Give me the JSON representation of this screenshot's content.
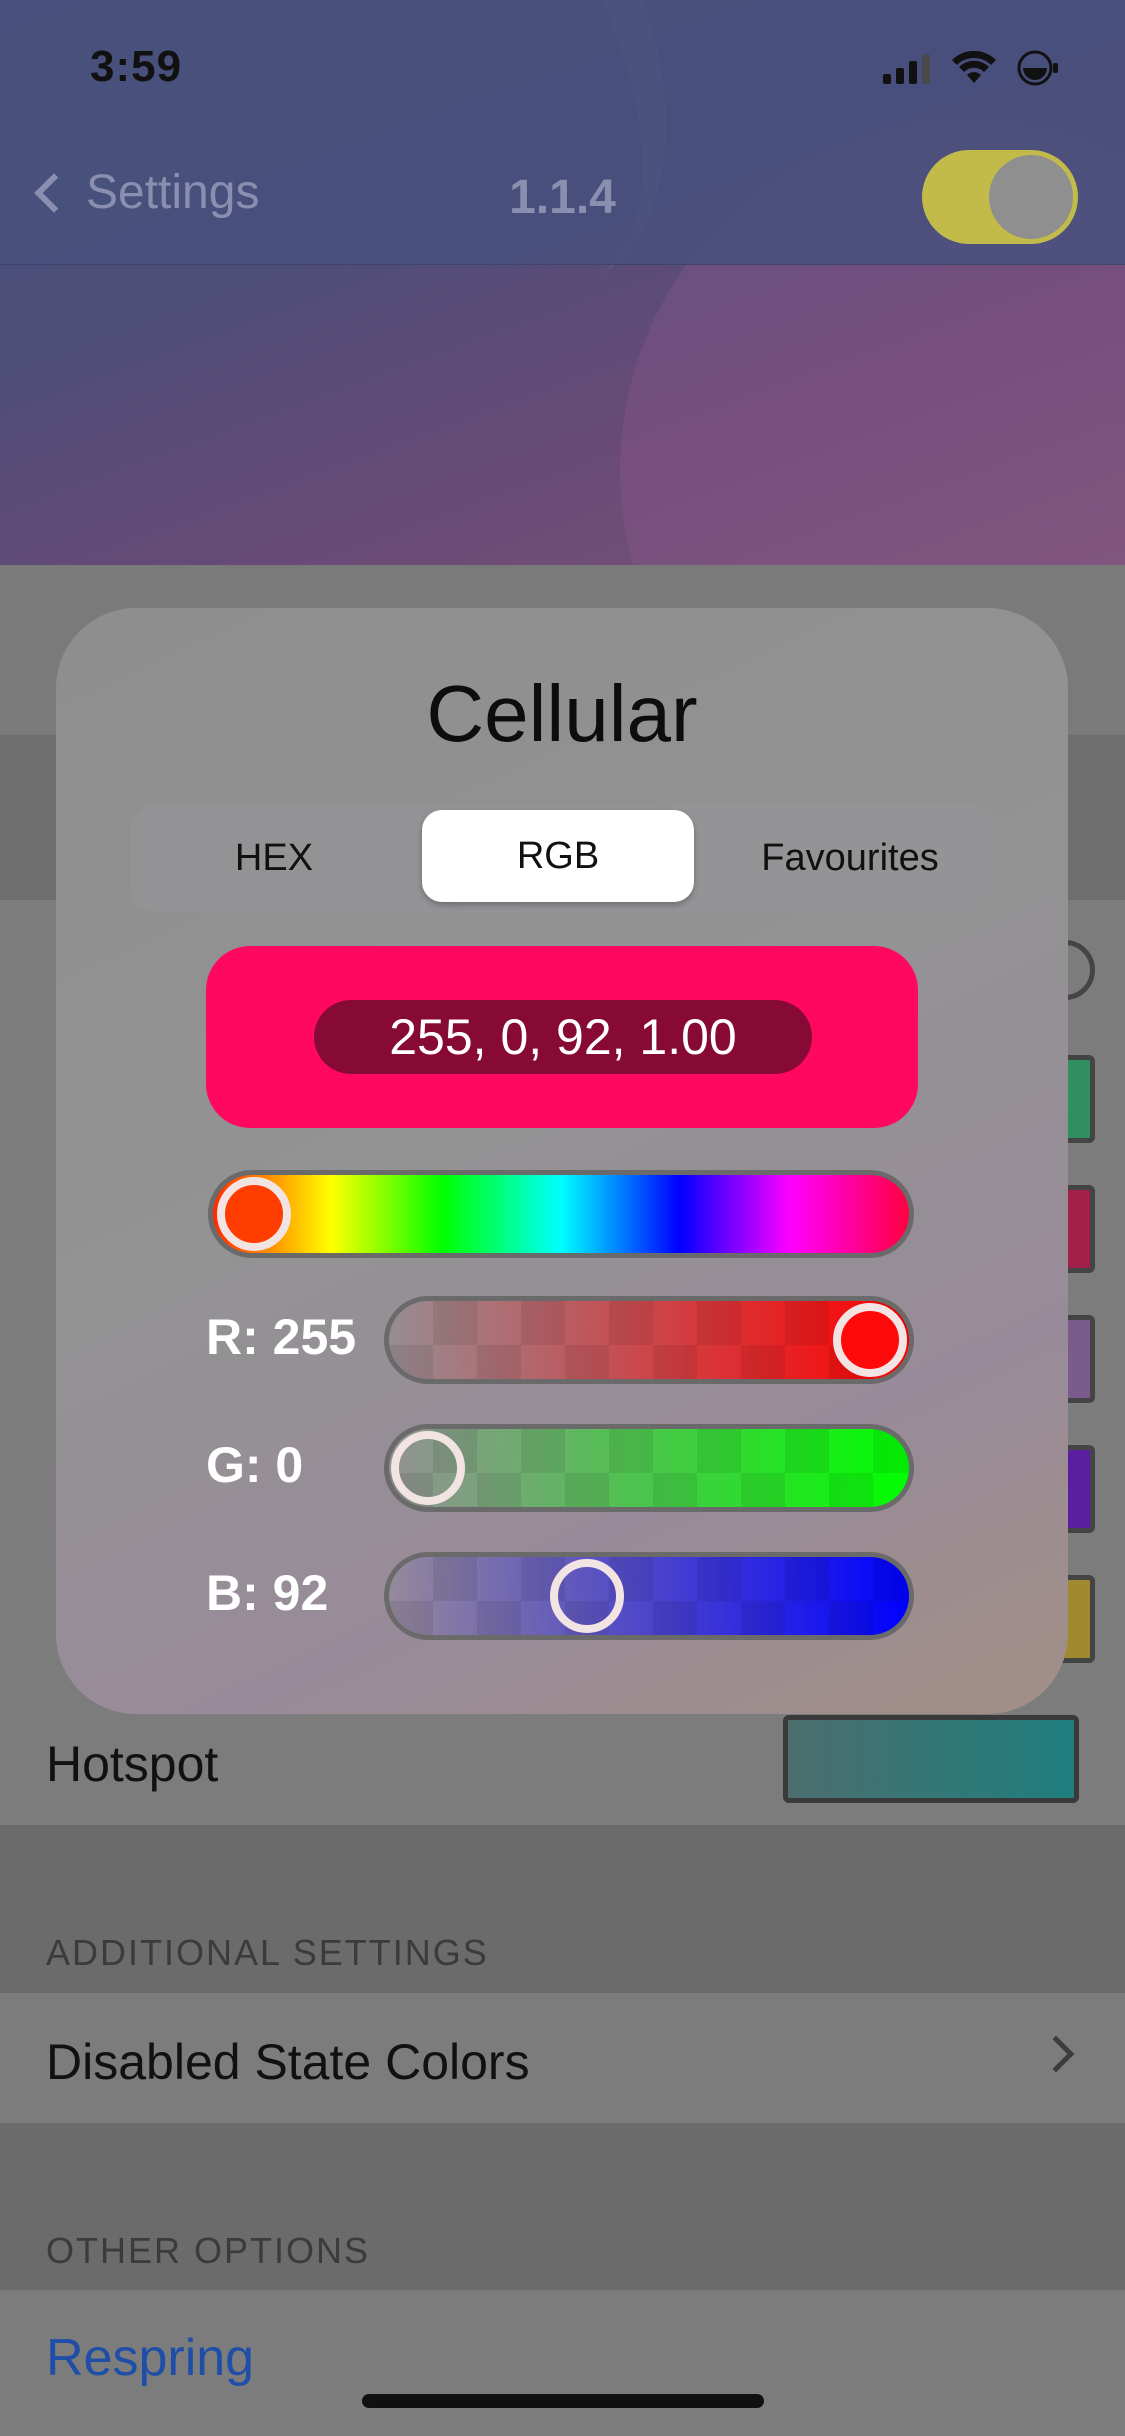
{
  "status_bar": {
    "time": "3:59"
  },
  "nav": {
    "back_label": "Settings",
    "title": "1.1.4",
    "enabled": true
  },
  "background": {
    "section_additional": "ADDITIONAL SETTINGS",
    "section_other": "OTHER OPTIONS",
    "hotspot_label": "Hotspot",
    "disabled_state_label": "Disabled State Colors",
    "respring_label": "Respring"
  },
  "popup": {
    "title": "Cellular",
    "tabs": [
      {
        "label": "HEX",
        "active": false
      },
      {
        "label": "RGB",
        "active": true
      },
      {
        "label": "Favourites",
        "active": false
      }
    ],
    "preview_color": "#ff0860",
    "value_text": "255, 0, 92, 1.00",
    "hue_fraction": 0.0,
    "channels": [
      {
        "label": "R: 255",
        "value": 255,
        "color": "#ff0000"
      },
      {
        "label": "G: 0",
        "value": 0,
        "color": "#00ff00"
      },
      {
        "label": "B: 92",
        "value": 92,
        "color": "#0000ff"
      }
    ]
  },
  "colors": {
    "accent_link": "#1e4ea8",
    "toggle_on": "#c2bb4a"
  }
}
